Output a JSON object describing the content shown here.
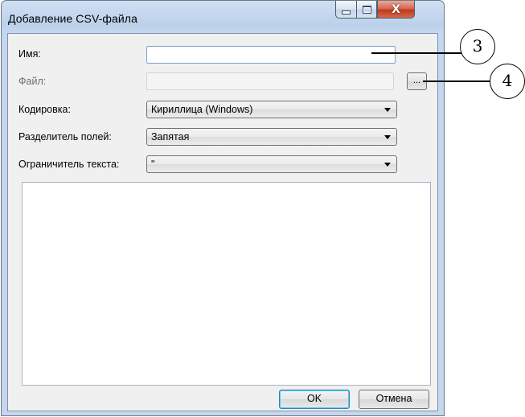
{
  "window": {
    "title": "Добавление CSV-файла",
    "close_glyph": "X"
  },
  "form": {
    "name_label": "Имя:",
    "name_value": "",
    "file_label": "Файл:",
    "file_value": "",
    "browse_label": "...",
    "encoding_label": "Кодировка:",
    "encoding_value": "Кириллица (Windows)",
    "separator_label": "Разделитель полей:",
    "separator_value": "Запятая",
    "qualifier_label": "Ограничитель текста:",
    "qualifier_value": "\""
  },
  "buttons": {
    "ok": "OK",
    "cancel": "Отмена"
  },
  "callouts": {
    "name_field": "3",
    "browse_button": "4"
  },
  "colors": {
    "titlebar": "#c4d7ee",
    "client_bg": "#f0f0f0",
    "close_button": "#c0391d"
  }
}
